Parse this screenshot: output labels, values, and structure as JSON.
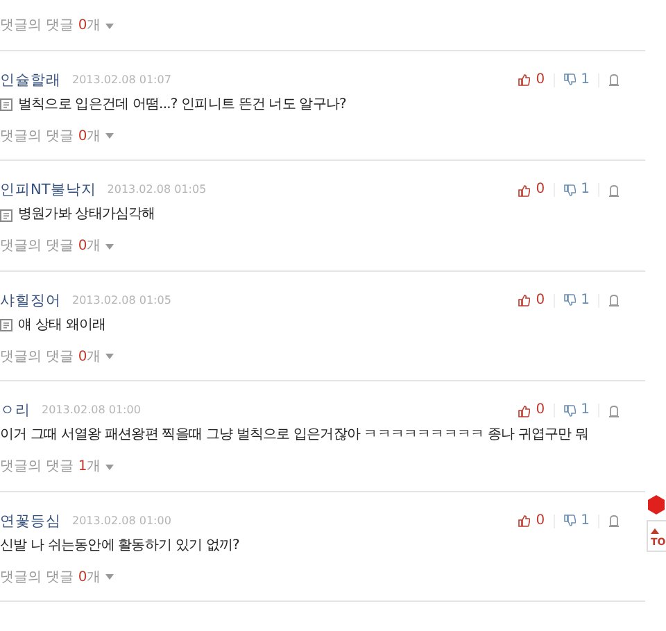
{
  "partial_comment": {
    "replies": {
      "label": "댓글의 댓글",
      "count": "0",
      "unit": "개"
    }
  },
  "comments": [
    {
      "author": "인슐할래",
      "date": "2013.02.08 01:07",
      "mobile": true,
      "body": "벌칙으로 입은건데 어떰...? 인피니트 뜬건 너도 알구나?",
      "likes": "0",
      "dislikes": "1",
      "replies": {
        "label": "댓글의 댓글",
        "count": "0",
        "unit": "개"
      }
    },
    {
      "author": "인피NT불낙지",
      "date": "2013.02.08 01:05",
      "mobile": true,
      "body": "병원가봐 상태가심각해",
      "likes": "0",
      "dislikes": "1",
      "replies": {
        "label": "댓글의 댓글",
        "count": "0",
        "unit": "개"
      }
    },
    {
      "author": "샤힐징어",
      "date": "2013.02.08 01:05",
      "mobile": true,
      "body": "얘 상태 왜이래",
      "likes": "0",
      "dislikes": "1",
      "replies": {
        "label": "댓글의 댓글",
        "count": "0",
        "unit": "개"
      }
    },
    {
      "author": "ㅇ리",
      "date": "2013.02.08 01:00",
      "mobile": false,
      "body": "이거 그때 서열왕 패션왕편 찍을때 그냥 벌칙으로 입은거잖아 ㅋㅋㅋㅋㅋㅋㅋㅋㅋ 종나 귀엽구만 뭐",
      "likes": "0",
      "dislikes": "1",
      "replies": {
        "label": "댓글의 댓글",
        "count": "1",
        "unit": "개"
      }
    },
    {
      "author": "연꽃등심",
      "date": "2013.02.08 01:00",
      "mobile": false,
      "body": "신발 나 쉬는동안에 활동하기 있기 없끼?",
      "likes": "0",
      "dislikes": "1",
      "replies": {
        "label": "댓글의 댓글",
        "count": "0",
        "unit": "개"
      }
    }
  ],
  "floating": {
    "top_label": "TO"
  }
}
